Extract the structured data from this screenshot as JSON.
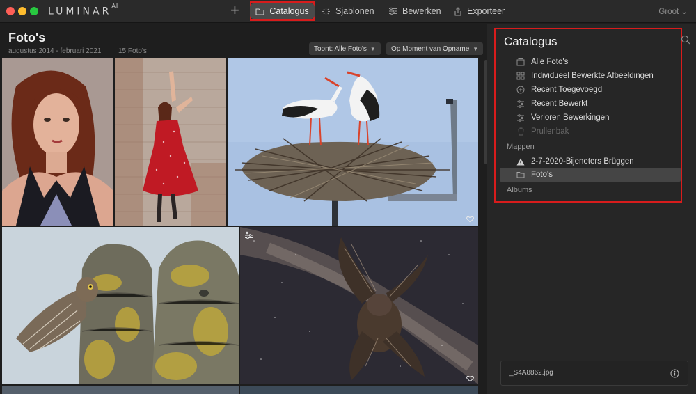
{
  "app": {
    "logo": "LUMINAR",
    "logo_sup": "AI"
  },
  "toolbar": {
    "add_icon": "plus-icon",
    "tabs": [
      {
        "label": "Catalogus",
        "icon": "folder-icon",
        "active": true
      },
      {
        "label": "Sjablonen",
        "icon": "sparkle-icon"
      },
      {
        "label": "Bewerken",
        "icon": "sliders-icon"
      },
      {
        "label": "Exporteer",
        "icon": "share-icon"
      }
    ],
    "size_label": "Groot ⌄"
  },
  "gallery": {
    "title": "Foto's",
    "date_range": "augustus 2014 - februari 2021",
    "count": "15 Foto's",
    "filter_label": "Toont: Alle Foto's",
    "sort_label": "Op Moment van Opname"
  },
  "catalog": {
    "title": "Catalogus",
    "items": [
      {
        "label": "Alle Foto's",
        "icon": "photos-icon"
      },
      {
        "label": "Individueel Bewerkte Afbeeldingen",
        "icon": "grid-icon"
      },
      {
        "label": "Recent Toegevoegd",
        "icon": "plus-circle-icon"
      },
      {
        "label": "Recent Bewerkt",
        "icon": "sliders-icon"
      },
      {
        "label": "Verloren Bewerkingen",
        "icon": "sliders-icon"
      },
      {
        "label": "Prullenbak",
        "icon": "trash-icon",
        "disabled": true
      }
    ],
    "folders_header": "Mappen",
    "folders": [
      {
        "label": "2-7-2020-Bijeneters Brüggen",
        "icon": "warning-icon"
      },
      {
        "label": "Foto's",
        "icon": "folder-icon",
        "selected": true
      }
    ],
    "albums_header": "Albums"
  },
  "file_info": {
    "name": "_S4A8862.jpg",
    "icon": "info-icon"
  },
  "colors": {
    "highlight_border": "#d81c1c",
    "background": "#1e1e1e",
    "panel": "#262626"
  }
}
